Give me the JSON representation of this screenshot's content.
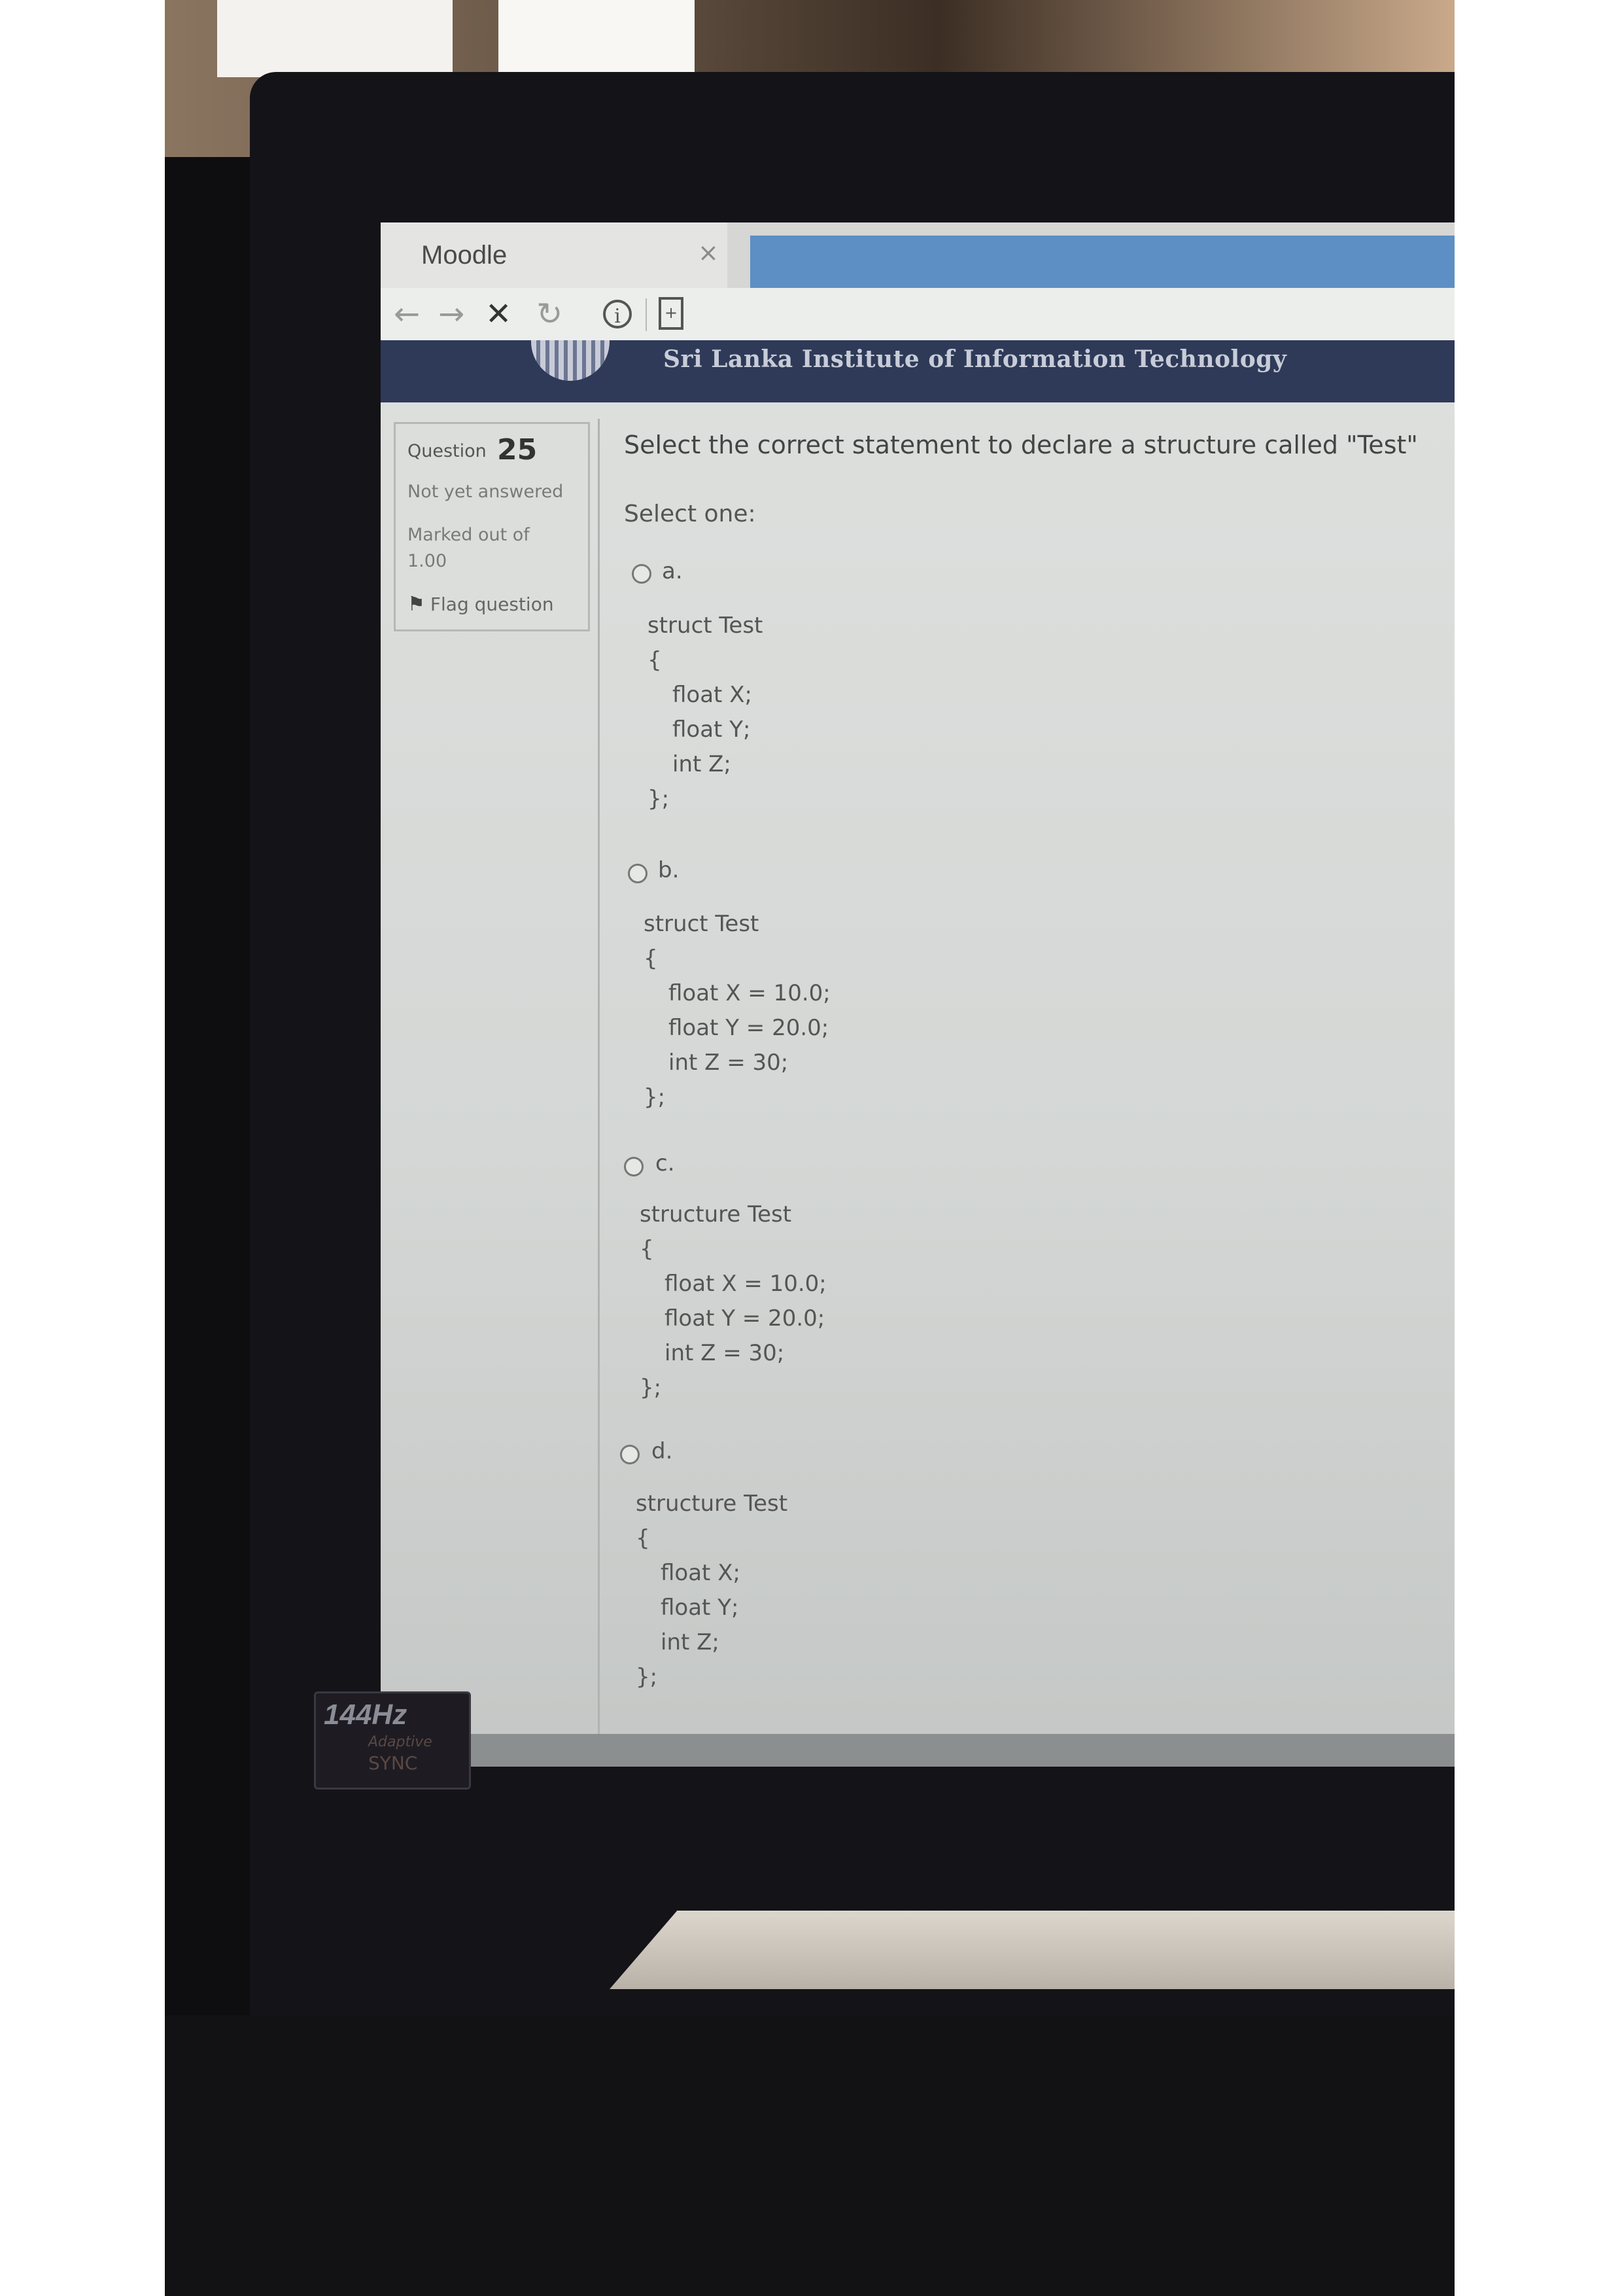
{
  "browser": {
    "tab_title": "Moodle",
    "tab_close": "×",
    "nav": {
      "back": "←",
      "forward": "→",
      "stop": "✕",
      "reload": "↻"
    },
    "info_icon": "ⓘ"
  },
  "site": {
    "title": "Sri Lanka Institute of Information Technology"
  },
  "question_info": {
    "label": "Question",
    "number": "25",
    "state": "Not yet answered",
    "marked_label": "Marked out of",
    "marked_value": "1.00",
    "flag_label": "Flag question"
  },
  "question": {
    "text": "Select the correct statement to declare a structure called \"Test\"",
    "prompt": "Select one:",
    "options": [
      {
        "letter": "a.",
        "lines": [
          "struct Test",
          "{",
          "float X;",
          "float Y;",
          "int Z;",
          "};"
        ]
      },
      {
        "letter": "b.",
        "lines": [
          "struct Test",
          "{",
          "float X = 10.0;",
          "float Y = 20.0;",
          "int Z = 30;",
          "};"
        ]
      },
      {
        "letter": "c.",
        "lines": [
          "structure Test",
          "{",
          "float X = 10.0;",
          "float Y = 20.0;",
          "int Z = 30;",
          "};"
        ]
      },
      {
        "letter": "d.",
        "lines": [
          "structure Test",
          "{",
          "float X;",
          "float Y;",
          "int Z;",
          "};"
        ]
      }
    ]
  },
  "sticker": {
    "refresh": "144Hz",
    "line1": "Adaptive",
    "line2": "SYNC"
  }
}
